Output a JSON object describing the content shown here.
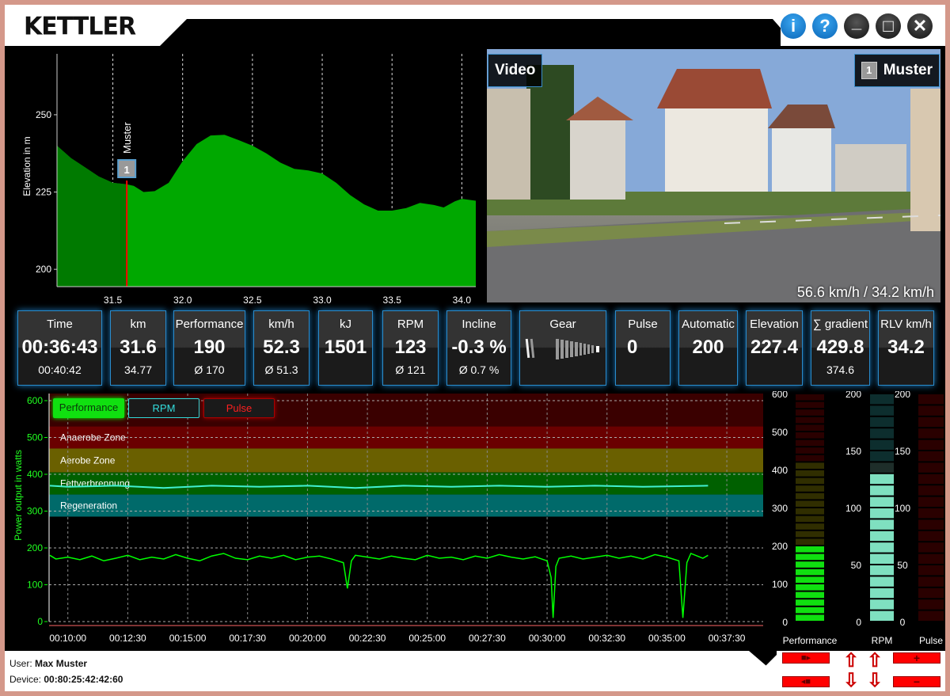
{
  "header": {
    "logo": "KETTLER",
    "buttons": [
      {
        "name": "info",
        "glyph": "i"
      },
      {
        "name": "help",
        "glyph": "?"
      },
      {
        "name": "minimize",
        "glyph": "_"
      },
      {
        "name": "maximize",
        "glyph": "□"
      },
      {
        "name": "close",
        "glyph": "✕"
      }
    ]
  },
  "elevation_chart": {
    "ylabel": "Elevation in m",
    "xlim": [
      31.1,
      34.1
    ],
    "ylim": [
      194.4,
      269.7
    ],
    "yticks": [
      200,
      225,
      250
    ],
    "xticks": [
      31.5,
      32.0,
      32.5,
      33.0,
      33.5,
      34.0
    ],
    "position_km": 31.6,
    "marker_label": "Muster",
    "marker_number": "1",
    "profile": [
      [
        31.1,
        240
      ],
      [
        31.2,
        236
      ],
      [
        31.3,
        233
      ],
      [
        31.4,
        230
      ],
      [
        31.5,
        228
      ],
      [
        31.6,
        227.5
      ],
      [
        31.65,
        227
      ],
      [
        31.72,
        225
      ],
      [
        31.8,
        225.3
      ],
      [
        31.9,
        228
      ],
      [
        32.0,
        235
      ],
      [
        32.1,
        240.5
      ],
      [
        32.2,
        243.3
      ],
      [
        32.3,
        243.5
      ],
      [
        32.4,
        241.8
      ],
      [
        32.5,
        240
      ],
      [
        32.6,
        237.5
      ],
      [
        32.7,
        234.5
      ],
      [
        32.8,
        232.5
      ],
      [
        32.9,
        232
      ],
      [
        33.0,
        231
      ],
      [
        33.1,
        228
      ],
      [
        33.2,
        224
      ],
      [
        33.3,
        221
      ],
      [
        33.4,
        219
      ],
      [
        33.5,
        219
      ],
      [
        33.6,
        219.8
      ],
      [
        33.7,
        221.5
      ],
      [
        33.8,
        220.8
      ],
      [
        33.87,
        220
      ],
      [
        33.95,
        222
      ],
      [
        34.0,
        222.8
      ],
      [
        34.1,
        222.2
      ]
    ],
    "colors": {
      "area": "#00a800",
      "ridden": "#007a00",
      "position": "#ff0000"
    }
  },
  "video": {
    "label": "Video",
    "rider_number": "1",
    "rider_name": "Muster",
    "speed_text": "56.6 km/h / 34.2 km/h"
  },
  "stats": [
    {
      "label": "Time",
      "value": "00:36:43",
      "sub": "00:40:42"
    },
    {
      "label": "km",
      "value": "31.6",
      "sub": "34.77"
    },
    {
      "label": "Performance",
      "value": "190",
      "sub": "Ø 170"
    },
    {
      "label": "km/h",
      "value": "52.3",
      "sub": "Ø 51.3"
    },
    {
      "label": "kJ",
      "value": "1501",
      "sub": ""
    },
    {
      "label": "RPM",
      "value": "123",
      "sub": "Ø 121"
    },
    {
      "label": "Incline",
      "value": "-0.3 %",
      "sub": "Ø 0.7 %"
    },
    {
      "label": "Gear",
      "value": "",
      "sub": ""
    },
    {
      "label": "Pulse",
      "value": "0",
      "sub": ""
    },
    {
      "label": "Automatic",
      "value": "200",
      "sub": ""
    },
    {
      "label": "Elevation",
      "value": "227.4",
      "sub": ""
    },
    {
      "label": "∑ gradient",
      "value": "429.8",
      "sub": "374.6"
    },
    {
      "label": "RLV km/h",
      "value": "34.2",
      "sub": ""
    }
  ],
  "power_chart": {
    "ylabel": "Power output in watts",
    "ylim": [
      0,
      600
    ],
    "yticks": [
      0,
      100,
      200,
      300,
      400,
      500,
      600
    ],
    "xlim": [
      "09:13",
      "39:01"
    ],
    "xticks": [
      "00:10:00",
      "00:12:30",
      "00:15:00",
      "00:17:30",
      "00:20:00",
      "00:22:30",
      "00:25:00",
      "00:27:30",
      "00:30:00",
      "00:32:30",
      "00:35:00",
      "00:37:30"
    ],
    "legend": [
      {
        "label": "Performance",
        "color": "#00ff00"
      },
      {
        "label": "RPM",
        "color": "#33dddd"
      },
      {
        "label": "Pulse",
        "color": "#ff2020"
      }
    ],
    "zones": [
      {
        "label": "",
        "from": 530,
        "to": 600,
        "color": "#3a0000"
      },
      {
        "label": "Anaerobe Zone",
        "from": 470,
        "to": 530,
        "color": "#6a0000"
      },
      {
        "label": "Aerobe Zone",
        "from": 405,
        "to": 470,
        "color": "#6a6000"
      },
      {
        "label": "Fettverbrennung",
        "from": 345,
        "to": 405,
        "color": "#006000"
      },
      {
        "label": "Regeneration",
        "from": 285,
        "to": 345,
        "color": "#006a6a"
      }
    ],
    "rpm_scale_max": 200,
    "performance": [
      [
        "09:15",
        180
      ],
      [
        "09:30",
        170
      ],
      [
        "10:00",
        175
      ],
      [
        "10:30",
        168
      ],
      [
        "11:00",
        178
      ],
      [
        "11:30",
        165
      ],
      [
        "12:00",
        172
      ],
      [
        "12:30",
        180
      ],
      [
        "13:00",
        168
      ],
      [
        "13:30",
        175
      ],
      [
        "14:00",
        170
      ],
      [
        "14:30",
        182
      ],
      [
        "15:00",
        172
      ],
      [
        "15:30",
        165
      ],
      [
        "16:00",
        178
      ],
      [
        "16:30",
        185
      ],
      [
        "17:00",
        172
      ],
      [
        "17:30",
        168
      ],
      [
        "18:00",
        178
      ],
      [
        "18:30",
        172
      ],
      [
        "19:00",
        180
      ],
      [
        "19:30",
        168
      ],
      [
        "20:00",
        175
      ],
      [
        "20:30",
        178
      ],
      [
        "21:00",
        170
      ],
      [
        "21:30",
        160
      ],
      [
        "21:40",
        90
      ],
      [
        "21:50",
        165
      ],
      [
        "22:00",
        180
      ],
      [
        "22:30",
        175
      ],
      [
        "23:00",
        170
      ],
      [
        "23:30",
        178
      ],
      [
        "24:00",
        172
      ],
      [
        "24:30",
        168
      ],
      [
        "25:00",
        180
      ],
      [
        "25:30",
        172
      ],
      [
        "26:00",
        175
      ],
      [
        "26:30",
        168
      ],
      [
        "27:00",
        178
      ],
      [
        "27:30",
        172
      ],
      [
        "28:00",
        182
      ],
      [
        "28:30",
        175
      ],
      [
        "29:00",
        170
      ],
      [
        "29:30",
        176
      ],
      [
        "30:00",
        165
      ],
      [
        "30:10",
        120
      ],
      [
        "30:15",
        10
      ],
      [
        "30:22",
        150
      ],
      [
        "30:30",
        172
      ],
      [
        "31:00",
        178
      ],
      [
        "31:30",
        170
      ],
      [
        "32:00",
        175
      ],
      [
        "32:30",
        180
      ],
      [
        "33:00",
        172
      ],
      [
        "33:30",
        178
      ],
      [
        "34:00",
        170
      ],
      [
        "34:30",
        182
      ],
      [
        "35:00",
        175
      ],
      [
        "35:30",
        165
      ],
      [
        "35:40",
        10
      ],
      [
        "35:50",
        160
      ],
      [
        "36:00",
        185
      ],
      [
        "36:30",
        172
      ],
      [
        "36:43",
        180
      ]
    ],
    "rpm": [
      [
        "09:15",
        123
      ],
      [
        "10:00",
        122
      ],
      [
        "12:00",
        123
      ],
      [
        "14:00",
        121
      ],
      [
        "16:00",
        123
      ],
      [
        "18:00",
        122
      ],
      [
        "20:00",
        123
      ],
      [
        "22:00",
        121
      ],
      [
        "24:00",
        123
      ],
      [
        "26:00",
        122
      ],
      [
        "28:00",
        123
      ],
      [
        "30:00",
        122
      ],
      [
        "32:00",
        123
      ],
      [
        "34:00",
        122
      ],
      [
        "36:43",
        123
      ]
    ]
  },
  "bars": [
    {
      "label": "Performance",
      "value": 190,
      "max": 600,
      "ticks": [
        0,
        100,
        200,
        300,
        400,
        500,
        600
      ],
      "on": "#10e010",
      "off_low": "#302e00",
      "off_high": "#2a0000"
    },
    {
      "label": "RPM",
      "value": 123,
      "max": 200,
      "ticks": [
        0,
        50,
        100,
        150,
        200
      ],
      "on": "#7fe0c0",
      "off_low": "#1e2e2a",
      "off_high": "#0d2e2e"
    },
    {
      "label": "Pulse",
      "value": 0,
      "max": 200,
      "ticks": [
        0,
        50,
        100,
        150,
        200
      ],
      "on": "#ff2020",
      "off_low": "#2a0000",
      "off_high": "#2a0000"
    }
  ],
  "footer": {
    "user_label": "User:",
    "user": "Max Muster",
    "device_label": "Device:",
    "device": "00:80:25:42:42:60"
  }
}
